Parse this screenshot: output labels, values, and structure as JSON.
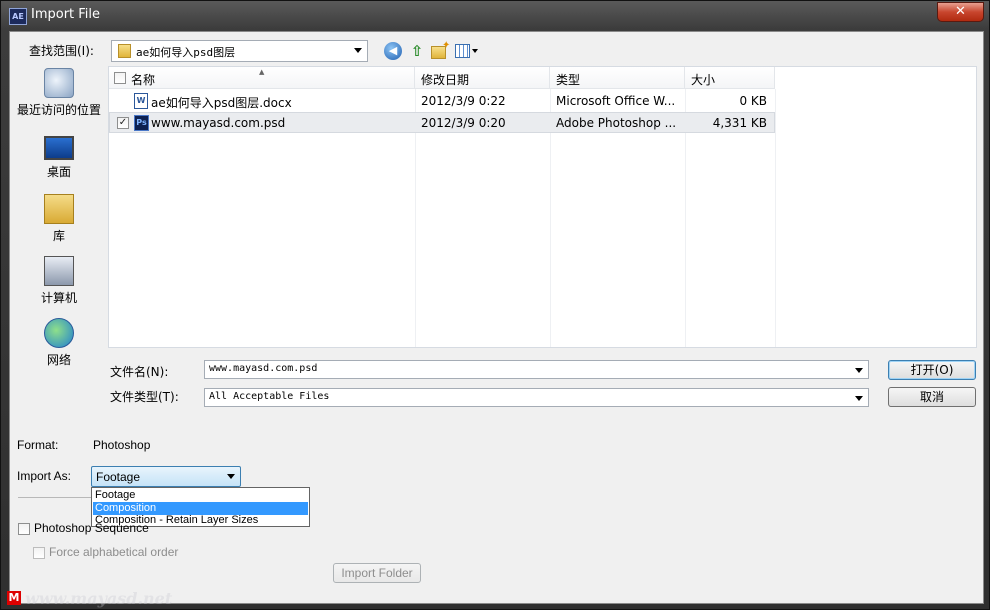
{
  "window": {
    "title": "Import File",
    "app_icon_text": "AE",
    "close_glyph": "✕"
  },
  "lookin": {
    "label": "查找范围(I):",
    "value": "ae如何导入psd图层"
  },
  "toolbar": {
    "icons": [
      "back-icon",
      "up-folder-icon",
      "new-folder-icon",
      "view-menu-icon"
    ]
  },
  "places": [
    {
      "label": "最近访问的位置",
      "icon": "recent-places-icon"
    },
    {
      "label": "桌面",
      "icon": "desktop-icon"
    },
    {
      "label": "库",
      "icon": "libraries-icon"
    },
    {
      "label": "计算机",
      "icon": "computer-icon"
    },
    {
      "label": "网络",
      "icon": "network-icon"
    }
  ],
  "columns": [
    "名称",
    "修改日期",
    "类型",
    "大小"
  ],
  "files": [
    {
      "name": "ae如何导入psd图层.docx",
      "date": "2012/3/9 0:22",
      "type": "Microsoft Office W...",
      "size": "0 KB",
      "checked": false,
      "icon": "word-doc-icon",
      "icon_text": "W"
    },
    {
      "name": "www.mayasd.com.psd",
      "date": "2012/3/9 0:20",
      "type": "Adobe Photoshop ...",
      "size": "4,331 KB",
      "checked": true,
      "icon": "photoshop-file-icon",
      "icon_text": "Ps"
    }
  ],
  "filename": {
    "label": "文件名(N):",
    "value": "www.mayasd.com.psd"
  },
  "filetype": {
    "label": "文件类型(T):",
    "value": "All Acceptable Files"
  },
  "buttons": {
    "open": "打开(O)",
    "cancel": "取消",
    "import_folder": "Import Folder"
  },
  "format": {
    "label": "Format:",
    "value": "Photoshop"
  },
  "import_as": {
    "label": "Import As:",
    "value": "Footage",
    "options": [
      "Footage",
      "Composition",
      "Composition - Retain Layer Sizes"
    ],
    "highlighted": "Composition"
  },
  "options": {
    "photoshop_sequence": "Photoshop Sequence",
    "force_alpha": "Force alphabetical order"
  },
  "watermark": {
    "logo": "M",
    "text": "www.mayasd.net"
  }
}
